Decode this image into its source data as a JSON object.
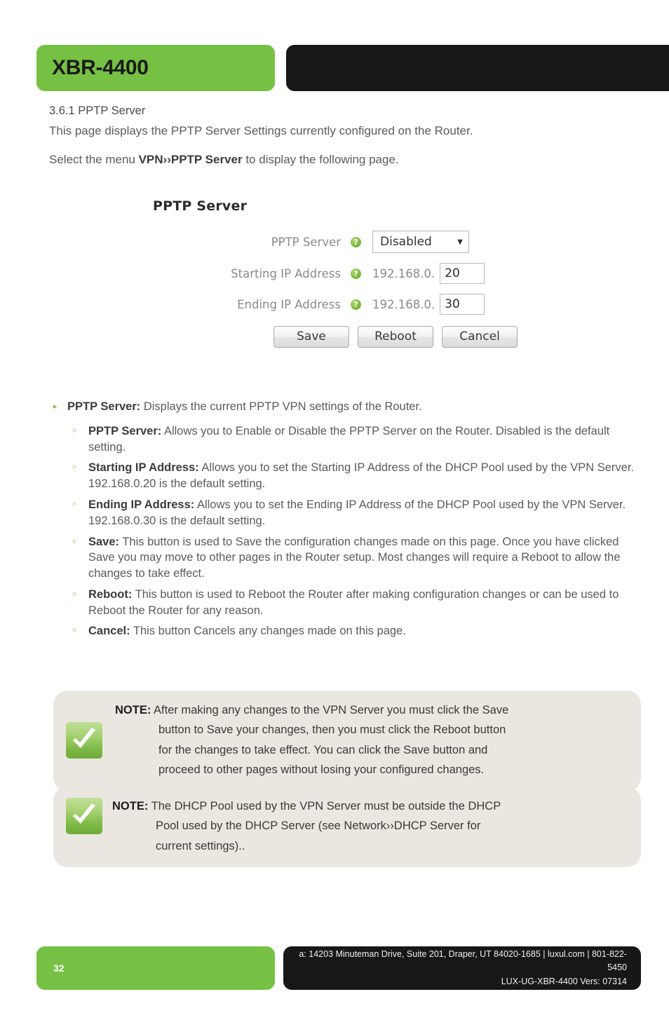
{
  "header": {
    "product_title": "XBR-4400"
  },
  "intro": {
    "section_number_title": "3.6.1 PPTP Server",
    "paragraph_1": "This page displays the PPTP Server Settings currently configured on the Router.",
    "paragraph_2_prefix": "Select the menu ",
    "paragraph_2_menu": "VPN››PPTP Server",
    "paragraph_2_suffix": " to display the following page."
  },
  "router_ui": {
    "panel_heading": "PPTP Server",
    "help_icon_glyph": "?",
    "rows": [
      {
        "label": "PPTP Server",
        "control": "select",
        "value": "Disabled",
        "caret": "▼"
      },
      {
        "label": "Starting IP Address",
        "control": "ip-input",
        "prefix": "192.168.0.",
        "value": "20"
      },
      {
        "label": "Ending IP Address",
        "control": "ip-input",
        "prefix": "192.168.0.",
        "value": "30"
      }
    ],
    "buttons": [
      {
        "label": "Save"
      },
      {
        "label": "Reboot"
      },
      {
        "label": "Cancel"
      }
    ]
  },
  "bullets": {
    "marker_level1": "▸",
    "marker_level2": "▹",
    "top": {
      "term": "PPTP Server:",
      "text": " Displays the current PPTP VPN settings of the Router."
    },
    "items": [
      {
        "term": "PPTP Server:",
        "text": " Allows you to Enable or Disable the PPTP Server on the Router. Disabled is the default setting."
      },
      {
        "term": "Starting IP Address:",
        "text": " Allows you to set the Starting IP Address of the DHCP Pool used by the VPN Server. 192.168.0.20 is the default setting."
      },
      {
        "term": "Ending IP Address:",
        "text": " Allows you to set the Ending IP Address of the DHCP Pool used by the VPN Server. 192.168.0.30 is the default setting."
      },
      {
        "term": "Save:",
        "text": " This button is used to Save the configuration changes made on this page. Once you have clicked Save you may move to other pages in the Router setup. Most changes will require a Reboot to allow the changes to take effect."
      },
      {
        "term": "Reboot:",
        "text": " This button is used to Reboot the Router after making configuration changes or can be used to Reboot the Router for any reason."
      },
      {
        "term": "Cancel:",
        "text": " This button Cancels any changes made on this page."
      }
    ]
  },
  "notes": [
    {
      "label": "NOTE:",
      "lines": [
        " After making any changes to the VPN Server you must click the Save",
        "button to Save your changes, then you must click the Reboot button",
        "for the changes to take effect. You can click the Save button and",
        "proceed to other pages without losing your configured changes."
      ]
    },
    {
      "label": "NOTE:",
      "lines": [
        " The DHCP Pool used by the VPN Server must be outside the DHCP",
        "Pool used by the DHCP Server (see Network››DHCP Server for",
        "current settings).."
      ]
    }
  ],
  "footer": {
    "page_number": "32",
    "address_line": "a: 14203 Minuteman Drive, Suite 201, Draper, UT 84020-1685 | luxul.com | 801-822-5450",
    "document_line": "LUX-UG-XBR-4400  Vers: 07314"
  },
  "colors": {
    "brand_green": "#76c043",
    "brand_black": "#171717",
    "note_background": "#eae7e0",
    "body_text": "#5b5b5b"
  }
}
